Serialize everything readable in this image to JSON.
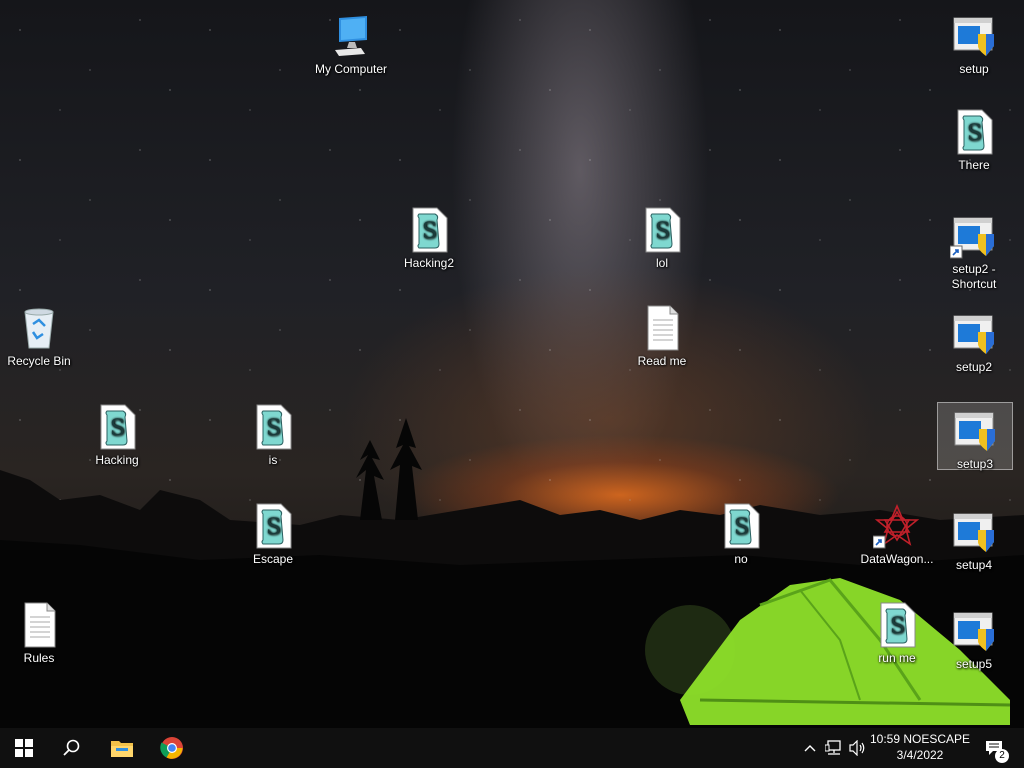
{
  "desktop": {
    "icons": {
      "my_computer": {
        "label": "My Computer"
      },
      "setup": {
        "label": "setup"
      },
      "there": {
        "label": "There"
      },
      "hacking2": {
        "label": "Hacking2"
      },
      "lol": {
        "label": "lol"
      },
      "setup2_shortcut": {
        "label": "setup2 - Shortcut"
      },
      "recycle_bin": {
        "label": "Recycle Bin"
      },
      "read_me": {
        "label": "Read me"
      },
      "setup2": {
        "label": "setup2"
      },
      "hacking": {
        "label": "Hacking"
      },
      "is": {
        "label": "is"
      },
      "setup3": {
        "label": "setup3"
      },
      "escape": {
        "label": "Escape"
      },
      "no": {
        "label": "no"
      },
      "datawagon": {
        "label": "DataWagon..."
      },
      "setup4": {
        "label": "setup4"
      },
      "rules": {
        "label": "Rules"
      },
      "run_me": {
        "label": "run me"
      },
      "setup5": {
        "label": "setup5"
      }
    }
  },
  "taskbar": {
    "start_icon": "windows-logo-icon",
    "search_icon": "search-icon",
    "file_explorer_icon": "folder-icon",
    "chrome_icon": "chrome-icon",
    "clock": {
      "time": "10:59 NOESCAPE",
      "date": "3/4/2022"
    },
    "notification_count": "2"
  },
  "colors": {
    "taskbar_bg": "#101010",
    "tent_green": "#8ee02a",
    "horizon_orange": "#e06a1e"
  }
}
